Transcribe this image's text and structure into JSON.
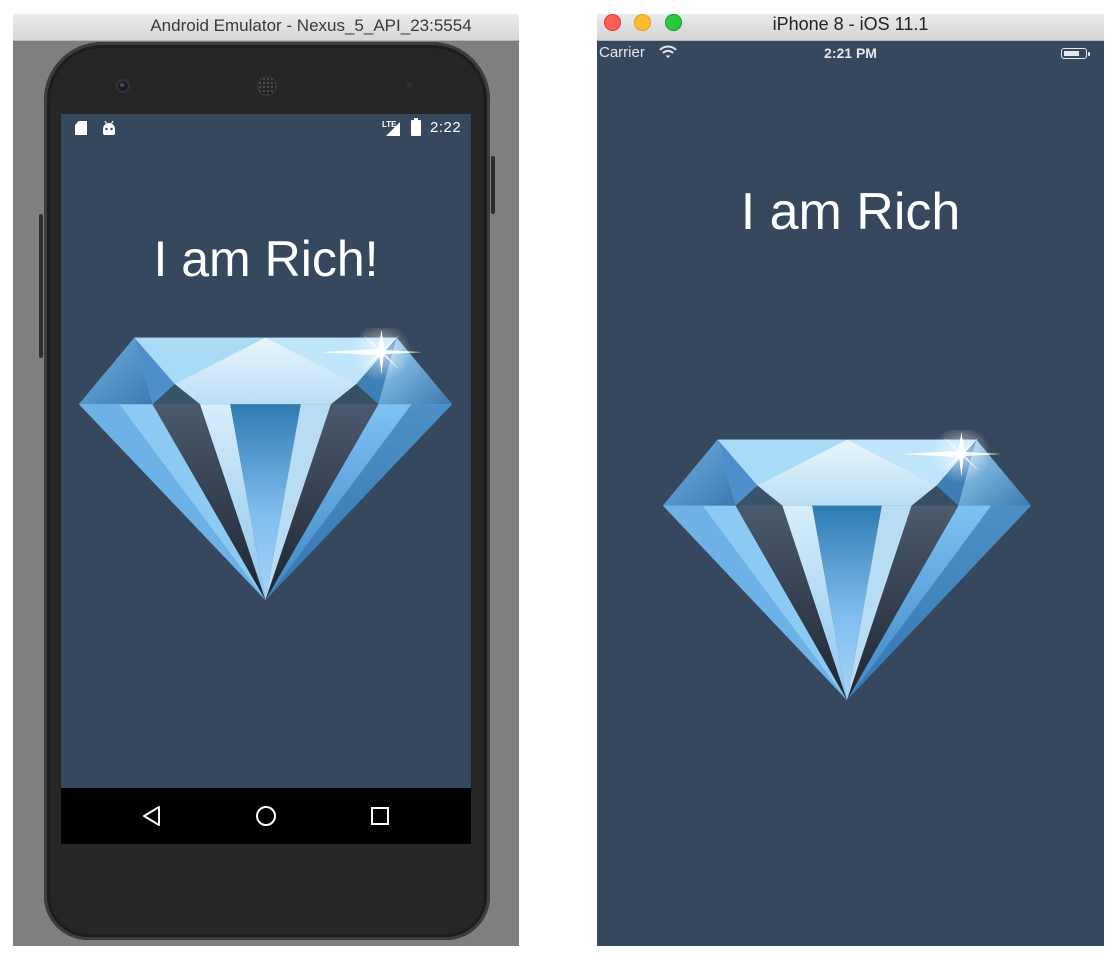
{
  "android": {
    "window_title": "Android Emulator - Nexus_5_API_23:5554",
    "status_bar": {
      "network_type": "LTE",
      "time": "2:22"
    },
    "app": {
      "heading": "I am Rich!"
    },
    "navigation": [
      "back-icon",
      "home-icon",
      "recents-icon"
    ]
  },
  "ios": {
    "window_title": "iPhone 8 - iOS 11.1",
    "status_bar": {
      "carrier": "Carrier",
      "time": "2:21 PM"
    },
    "app": {
      "heading": "I am Rich"
    }
  },
  "colors": {
    "screen_background": "#36485d",
    "close_light": "#fd5f57",
    "minimize_light": "#febc2e",
    "zoom_light": "#28c840"
  }
}
